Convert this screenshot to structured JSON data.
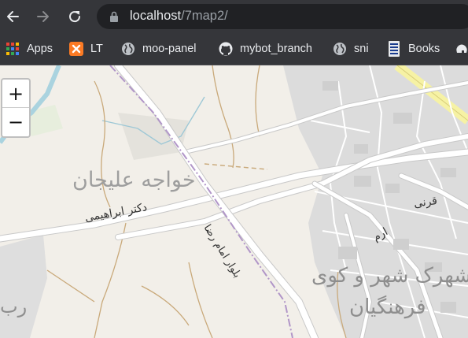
{
  "browser": {
    "url_host": "localhost",
    "url_path": "/7map2/",
    "bookmarks": [
      {
        "label": "Apps",
        "icon": "apps-grid-icon"
      },
      {
        "label": "LT",
        "icon": "xampp-icon"
      },
      {
        "label": "moo-panel",
        "icon": "globe-icon"
      },
      {
        "label": "mybot_branch",
        "icon": "github-icon"
      },
      {
        "label": "sni",
        "icon": "globe-icon"
      },
      {
        "label": "Books",
        "icon": "book-icon"
      }
    ]
  },
  "map": {
    "zoom_in": "+",
    "zoom_out": "−",
    "labels": {
      "district_1": "خواجه علیجان",
      "street_1": "دکتر ابراهیمی",
      "boulevard": "بلوار امام رضا",
      "street_2": "قرنی",
      "street_3": "ارم",
      "district_2_line1": "شهرک شهر و کوی",
      "district_2_line2": "فرهنگیان",
      "partial_left": "رب"
    }
  }
}
